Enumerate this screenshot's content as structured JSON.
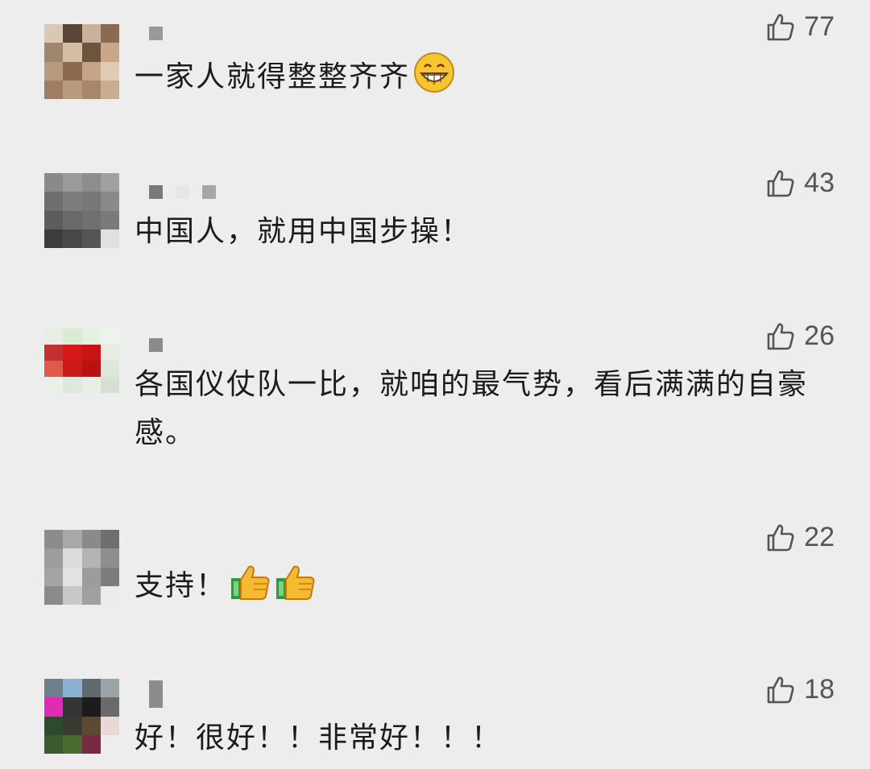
{
  "comments": [
    {
      "text": "一家人就得整整齐齐",
      "likes": "77",
      "emojis": [
        "grinning-face"
      ]
    },
    {
      "text": "中国人，就用中国步操！",
      "likes": "43",
      "emojis": []
    },
    {
      "text": "各国仪仗队一比，就咱的最气势，看后满满的自豪感。",
      "likes": "26",
      "emojis": []
    },
    {
      "text": "支持！",
      "likes": "22",
      "emojis": [
        "thumbs-up",
        "thumbs-up"
      ]
    },
    {
      "text": "好！很好！！非常好！！！",
      "likes": "18",
      "emojis": []
    }
  ],
  "icons": {
    "like": "thumbs-up-outline-icon"
  },
  "colors": {
    "background": "#ededed",
    "text": "#1b1b1b",
    "like": "#555555"
  }
}
